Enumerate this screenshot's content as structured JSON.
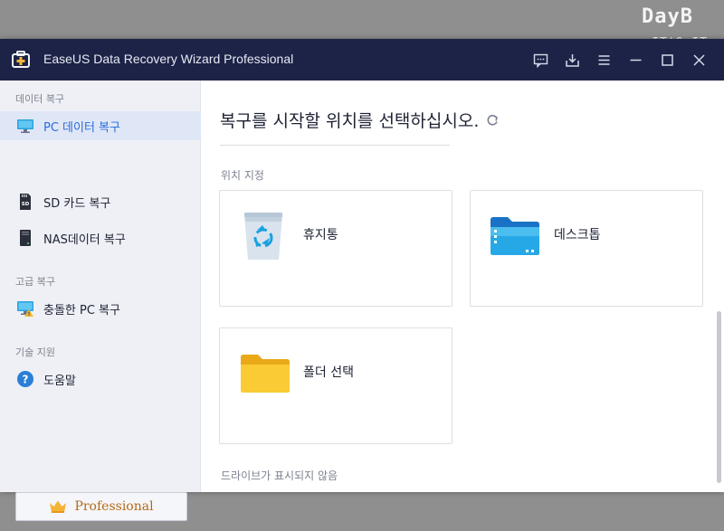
{
  "watermark": {
    "line1": "DayB",
    "line2": "IT'S IT"
  },
  "window": {
    "title": "EaseUS Data Recovery Wizard Professional"
  },
  "titlebar_buttons": [
    "feedback-icon",
    "download-icon",
    "menu-icon",
    "minimize-icon",
    "maximize-icon",
    "close-icon"
  ],
  "sidebar": {
    "sections": [
      {
        "label": "데이터 복구",
        "items": [
          {
            "label": "PC 데이터 복구",
            "icon": "monitor-icon",
            "active": true
          },
          {
            "label": "SD 카드 복구",
            "icon": "sd-card-icon"
          },
          {
            "label": "NAS데이터 복구",
            "icon": "nas-icon"
          }
        ]
      },
      {
        "label": "고급 복구",
        "items": [
          {
            "label": "충돌한 PC 복구",
            "icon": "crashed-pc-icon"
          }
        ]
      },
      {
        "label": "기술 지원",
        "items": [
          {
            "label": "도움말",
            "icon": "help-icon"
          }
        ]
      }
    ],
    "upgrade": {
      "label": "Professional",
      "icon": "crown-icon"
    }
  },
  "main": {
    "heading": "복구를 시작할 위치를 선택하십시오.",
    "section_label": "위치 지정",
    "locations": [
      {
        "label": "휴지통",
        "icon": "recycle-bin-icon"
      },
      {
        "label": "데스크톱",
        "icon": "desktop-folder-icon"
      },
      {
        "label": "폴더 선택",
        "icon": "folder-icon"
      }
    ],
    "drives_label": "드라이브가 표시되지 않음"
  },
  "colors": {
    "titlebar": "#1c2347",
    "accent": "#2a6bd8",
    "sidebar": "#eef0f5",
    "pro_text": "#b36a16"
  }
}
